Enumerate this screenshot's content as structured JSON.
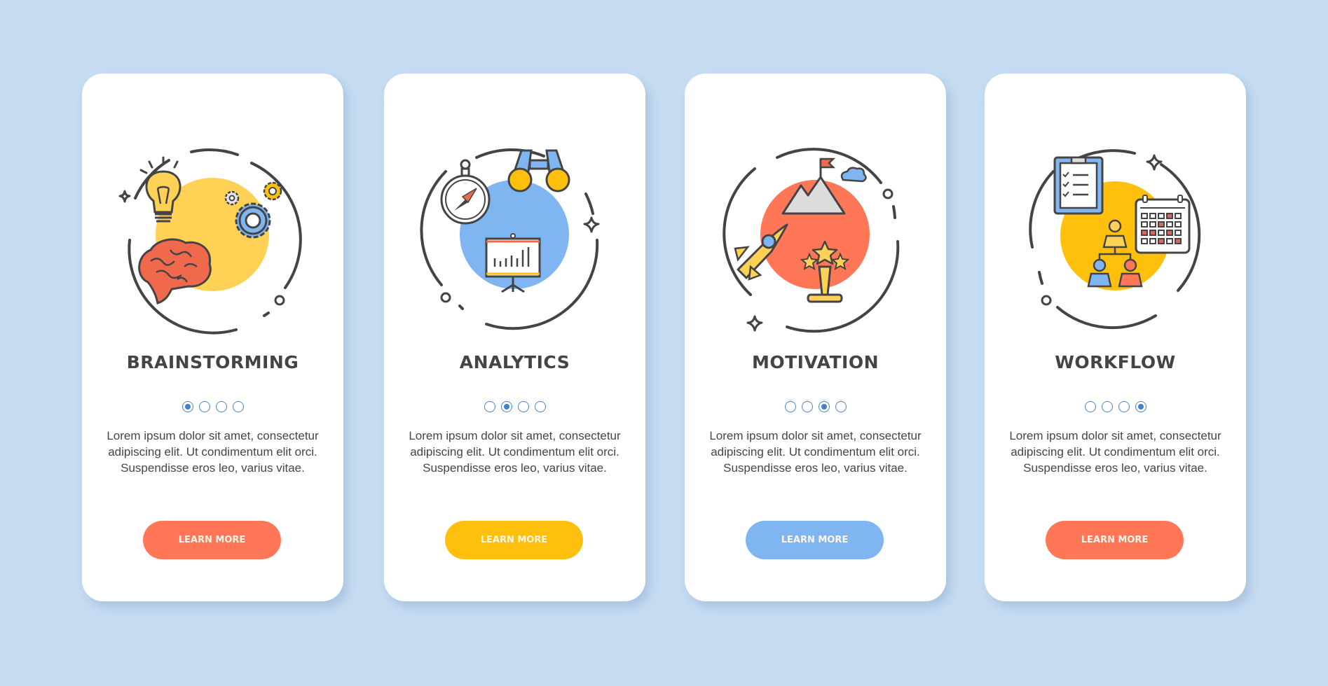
{
  "colors": {
    "background": "#c5dcf2",
    "coral": "#ff7757",
    "yellow": "#ffc00d",
    "light_blue": "#7fb6f2",
    "pager_active": "#3f7fcb",
    "outline": "#444444"
  },
  "cards": [
    {
      "title": "BRAINSTORMING",
      "illustration": [
        "lightbulb-icon",
        "gears-icon",
        "brain-icon",
        "sparkle-icon"
      ],
      "accent": "#ffd154",
      "pager": {
        "total": 4,
        "active": 1
      },
      "body": "Lorem ipsum dolor sit amet, consectetur adipiscing elit. Ut condimentum elit orci. Suspendisse eros leo, varius vitae.",
      "button_label": "LEARN MORE",
      "button_color": "#ff7757"
    },
    {
      "title": "ANALYTICS",
      "illustration": [
        "compass-icon",
        "binoculars-icon",
        "presentation-chart-icon",
        "sparkle-icon"
      ],
      "accent": "#7fb6f2",
      "pager": {
        "total": 4,
        "active": 2
      },
      "body": "Lorem ipsum dolor sit amet, consectetur adipiscing elit. Ut condimentum elit orci. Suspendisse eros leo, varius vitae.",
      "button_label": "LEARN MORE",
      "button_color": "#ffc00d"
    },
    {
      "title": "MOTIVATION",
      "illustration": [
        "mountain-flag-icon",
        "rocket-icon",
        "trophy-icon",
        "cloud-icon",
        "sparkle-icon"
      ],
      "accent": "#ff7757",
      "pager": {
        "total": 4,
        "active": 3
      },
      "body": "Lorem ipsum dolor sit amet, consectetur adipiscing elit. Ut condimentum elit orci. Suspendisse eros leo, varius vitae.",
      "button_label": "LEARN MORE",
      "button_color": "#7fb6f2"
    },
    {
      "title": "WORKFLOW",
      "illustration": [
        "clipboard-checklist-icon",
        "calendar-icon",
        "org-chart-icon",
        "sparkle-icon"
      ],
      "accent": "#ffc00d",
      "pager": {
        "total": 4,
        "active": 4
      },
      "body": "Lorem ipsum dolor sit amet, consectetur adipiscing elit. Ut condimentum elit orci. Suspendisse eros leo, varius vitae.",
      "button_label": "LEARN MORE",
      "button_color": "#ff7757"
    }
  ]
}
